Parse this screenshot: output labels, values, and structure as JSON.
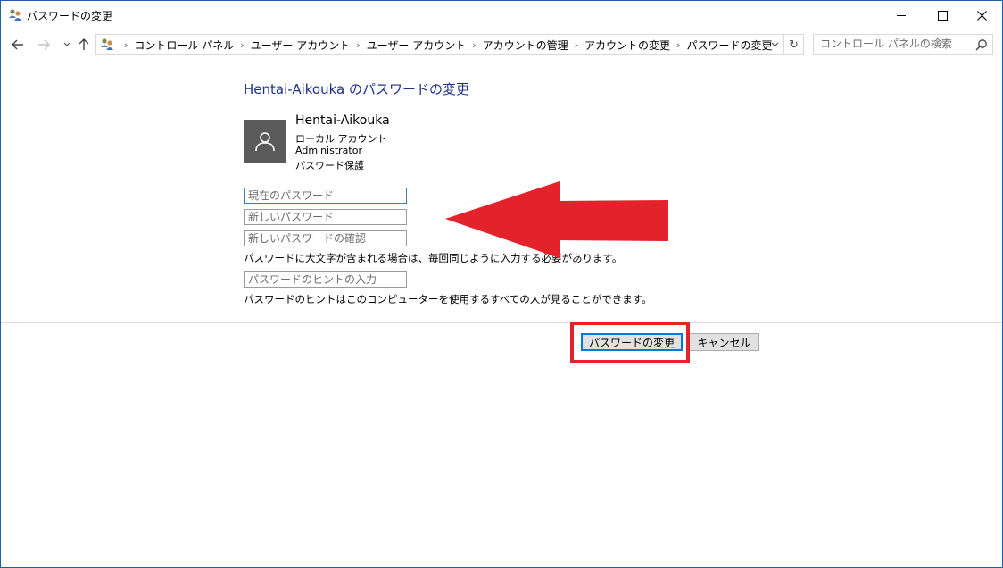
{
  "window": {
    "title": "パスワードの変更",
    "minimize_icon": "minimize-icon",
    "maximize_icon": "maximize-icon",
    "close_icon": "close-icon"
  },
  "nav": {
    "breadcrumbs": [
      "コントロール パネル",
      "ユーザー アカウント",
      "ユーザー アカウント",
      "アカウントの管理",
      "アカウントの変更",
      "パスワードの変更"
    ],
    "search_placeholder": "コントロール パネルの検索"
  },
  "main": {
    "title": "Hentai-Aikouka のパスワードの変更",
    "user": {
      "name": "Hentai-Aikouka",
      "account_type": "ローカル アカウント",
      "role": "Administrator",
      "protection": "パスワード保護"
    },
    "fields": {
      "current_password_placeholder": "現在のパスワード",
      "new_password_placeholder": "新しいパスワード",
      "confirm_password_placeholder": "新しいパスワードの確認",
      "hint_placeholder": "パスワードのヒントの入力"
    },
    "case_note": "パスワードに大文字が含まれる場合は、毎回同じように入力する必要があります。",
    "hint_note": "パスワードのヒントはこのコンピューターを使用するすべての人が見ることができます。"
  },
  "buttons": {
    "change_password": "パスワードの変更",
    "cancel": "キャンセル"
  },
  "annotations": {
    "color": "#e4222c"
  }
}
